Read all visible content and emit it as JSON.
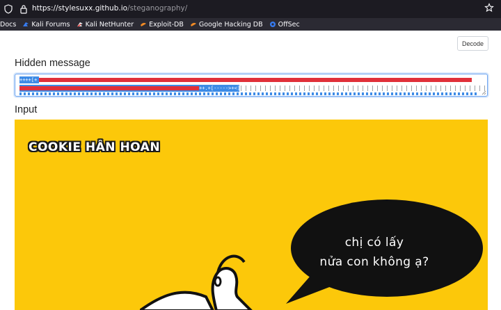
{
  "browser": {
    "url_host": "https://stylesuxx.github.io",
    "url_path": "/steganography/"
  },
  "bookmarks": [
    {
      "label": "Docs",
      "icon": "none"
    },
    {
      "label": "Kali Forums",
      "icon": "kali-dragon-icon"
    },
    {
      "label": "Kali NetHunter",
      "icon": "nethunter-icon"
    },
    {
      "label": "Exploit-DB",
      "icon": "exploitdb-icon"
    },
    {
      "label": "Google Hacking DB",
      "icon": "ghdb-icon"
    },
    {
      "label": "OffSec",
      "icon": "offsec-icon"
    }
  ],
  "toolbar": {
    "decode_label": "Decode"
  },
  "hidden_message": {
    "title": "Hidden message",
    "line1_prefix": "++++[+",
    "line2_code": "++.+[----->+<]>"
  },
  "input": {
    "title": "Input",
    "image": {
      "brand": "COOKIE HÂN HOAN",
      "bubble_line1": "chị có lấy",
      "bubble_line2": "nửa con không ạ?"
    }
  },
  "colors": {
    "chrome_bg": "#1c1b22",
    "bookmarks_bg": "#2b2a33",
    "selection": "#3d8be6",
    "highlight_red": "#e0303a",
    "image_bg": "#fcc80a"
  }
}
